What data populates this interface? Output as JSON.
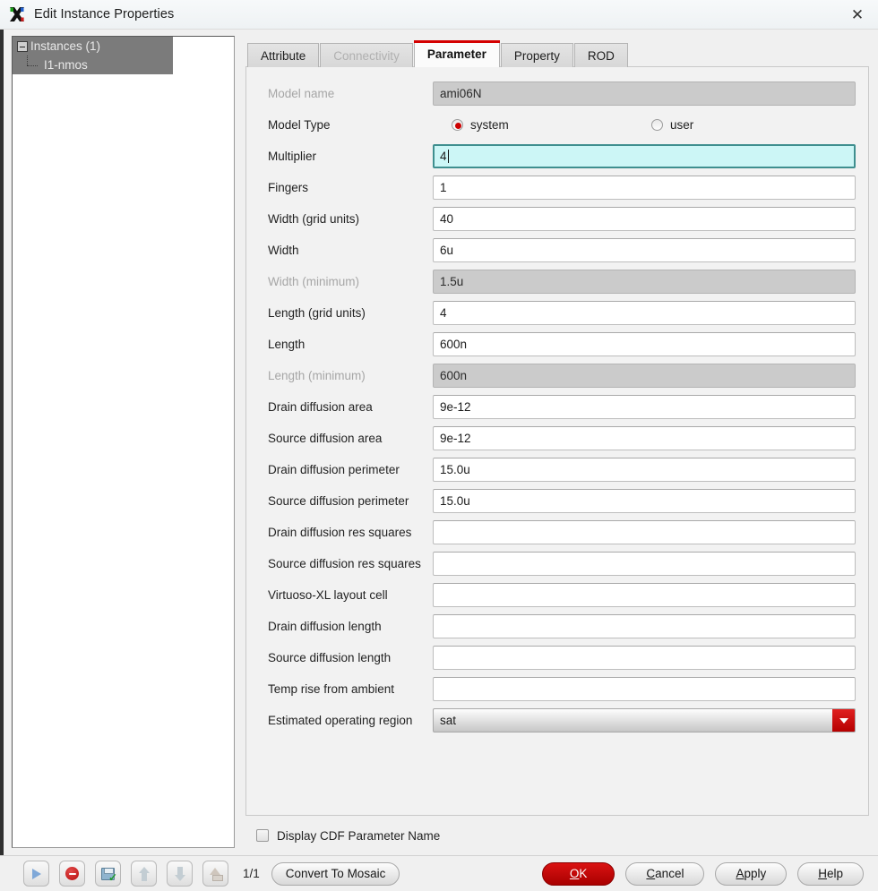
{
  "window": {
    "title": "Edit Instance Properties",
    "app_icon": "cadence-x-icon",
    "close_label": "✕"
  },
  "tree": {
    "root_label": "Instances (1)",
    "child_label": "I1-nmos"
  },
  "tabs": [
    {
      "label": "Attribute",
      "state": "normal"
    },
    {
      "label": "Connectivity",
      "state": "disabled"
    },
    {
      "label": "Parameter",
      "state": "active"
    },
    {
      "label": "Property",
      "state": "normal"
    },
    {
      "label": "ROD",
      "state": "normal"
    }
  ],
  "form": {
    "model_name": {
      "label": "Model name",
      "value": "ami06N",
      "readonly": true
    },
    "model_type": {
      "label": "Model Type",
      "options": [
        {
          "label": "system",
          "selected": true
        },
        {
          "label": "user",
          "selected": false
        }
      ]
    },
    "fields": [
      {
        "label": "Multiplier",
        "value": "4",
        "readonly": false,
        "focused": true
      },
      {
        "label": "Fingers",
        "value": "1",
        "readonly": false,
        "focused": false
      },
      {
        "label": "Width (grid units)",
        "value": "40",
        "readonly": false,
        "focused": false
      },
      {
        "label": "Width",
        "value": "6u",
        "readonly": false,
        "focused": false
      },
      {
        "label": "Width (minimum)",
        "value": "1.5u",
        "readonly": true,
        "focused": false
      },
      {
        "label": "Length (grid units)",
        "value": "4",
        "readonly": false,
        "focused": false
      },
      {
        "label": "Length",
        "value": "600n",
        "readonly": false,
        "focused": false
      },
      {
        "label": "Length (minimum)",
        "value": "600n",
        "readonly": true,
        "focused": false
      },
      {
        "label": "Drain diffusion area",
        "value": "9e-12",
        "readonly": false,
        "focused": false
      },
      {
        "label": "Source diffusion area",
        "value": "9e-12",
        "readonly": false,
        "focused": false
      },
      {
        "label": "Drain diffusion perimeter",
        "value": "15.0u",
        "readonly": false,
        "focused": false
      },
      {
        "label": "Source diffusion perimeter",
        "value": "15.0u",
        "readonly": false,
        "focused": false
      },
      {
        "label": "Drain diffusion res squares",
        "value": "",
        "readonly": false,
        "focused": false
      },
      {
        "label": "Source diffusion res squares",
        "value": "",
        "readonly": false,
        "focused": false
      },
      {
        "label": "Virtuoso-XL layout cell",
        "value": "",
        "readonly": false,
        "focused": false
      },
      {
        "label": "Drain diffusion length",
        "value": "",
        "readonly": false,
        "focused": false
      },
      {
        "label": "Source diffusion length",
        "value": "",
        "readonly": false,
        "focused": false
      },
      {
        "label": "Temp rise from ambient",
        "value": "",
        "readonly": false,
        "focused": false
      }
    ],
    "operating_region": {
      "label": "Estimated operating region",
      "value": "sat",
      "options": [
        "sat"
      ]
    },
    "display_cdf": {
      "label": "Display CDF Parameter Name",
      "checked": false
    }
  },
  "bottombar": {
    "icons": [
      {
        "name": "play-icon",
        "title": "Play"
      },
      {
        "name": "stop-delete-icon",
        "title": "Stop"
      },
      {
        "name": "save-disk-icon",
        "title": "Save"
      },
      {
        "name": "arrow-up-icon",
        "title": "Up"
      },
      {
        "name": "arrow-down-icon",
        "title": "Down"
      },
      {
        "name": "hierarchy-icon",
        "title": "Descend"
      }
    ],
    "page_indicator": "1/1",
    "convert_label": "Convert To Mosaic",
    "ok": {
      "pre": "O",
      "mnemonic": "",
      "post": "K"
    },
    "ok_mn": "O",
    "ok_rest": "K",
    "cancel_mn": "C",
    "cancel_rest": "ancel",
    "apply_mn": "A",
    "apply_rest": "pply",
    "help_mn": "H",
    "help_rest": "elp"
  },
  "colors": {
    "accent_red": "#cc0000",
    "focus_cyan": "#ccf6f6",
    "tab_active_border": "#d40000",
    "tree_selection": "#7b7b7b"
  }
}
